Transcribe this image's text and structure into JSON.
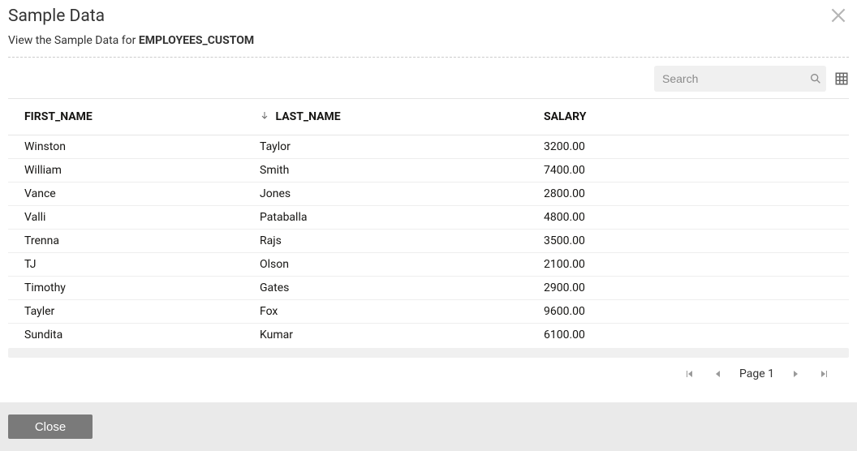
{
  "header": {
    "title": "Sample Data",
    "subtitle_prefix": "View the Sample Data for ",
    "subtitle_table": "EMPLOYEES_CUSTOM"
  },
  "search": {
    "placeholder": "Search",
    "value": ""
  },
  "columns": [
    {
      "key": "first_name",
      "label": "FIRST_NAME",
      "sorted": false
    },
    {
      "key": "last_name",
      "label": "LAST_NAME",
      "sorted": "desc"
    },
    {
      "key": "salary",
      "label": "SALARY",
      "sorted": false
    }
  ],
  "rows": [
    {
      "first_name": "Winston",
      "last_name": "Taylor",
      "salary": "3200.00"
    },
    {
      "first_name": "William",
      "last_name": "Smith",
      "salary": "7400.00"
    },
    {
      "first_name": "Vance",
      "last_name": "Jones",
      "salary": "2800.00"
    },
    {
      "first_name": "Valli",
      "last_name": "Pataballa",
      "salary": "4800.00"
    },
    {
      "first_name": "Trenna",
      "last_name": "Rajs",
      "salary": "3500.00"
    },
    {
      "first_name": "TJ",
      "last_name": "Olson",
      "salary": "2100.00"
    },
    {
      "first_name": "Timothy",
      "last_name": "Gates",
      "salary": "2900.00"
    },
    {
      "first_name": "Tayler",
      "last_name": "Fox",
      "salary": "9600.00"
    },
    {
      "first_name": "Sundita",
      "last_name": "Kumar",
      "salary": "6100.00"
    }
  ],
  "pager": {
    "label_prefix": "Page",
    "page": "1"
  },
  "buttons": {
    "close": "Close"
  }
}
